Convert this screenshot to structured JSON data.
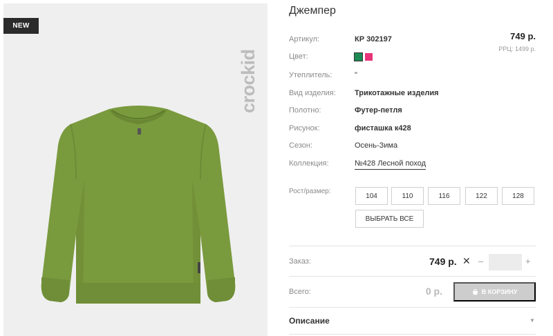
{
  "badge": "NEW",
  "brand": "crockid",
  "product": {
    "title": "Джемпер",
    "price": "749 р.",
    "rrp": "РРЦ: 1499 р."
  },
  "attributes": {
    "sku": {
      "label": "Артикул:",
      "value": "КР 302197"
    },
    "color": {
      "label": "Цвет:",
      "swatches": [
        "#1d8a55",
        "#e8347a"
      ]
    },
    "insulation": {
      "label": "Утеплитель:",
      "value": "\""
    },
    "type": {
      "label": "Вид изделия:",
      "value": "Трикотажные изделия"
    },
    "fabric": {
      "label": "Полотно:",
      "value": "Футер-петля"
    },
    "pattern": {
      "label": "Рисунок:",
      "value": "фисташка к428"
    },
    "season": {
      "label": "Сезон:",
      "value": "Осень-Зима"
    },
    "collection": {
      "label": "Коллекция:",
      "value": "№428 Лесной поход"
    }
  },
  "sizes": {
    "label": "Рост/размер:",
    "options": [
      "104",
      "110",
      "116",
      "122",
      "128"
    ],
    "select_all": "ВЫБРАТЬ ВСЕ"
  },
  "order": {
    "label": "Заказ:",
    "price": "749 р.",
    "times": "✕",
    "minus": "–",
    "quantity": "",
    "plus": "+"
  },
  "total": {
    "label": "Всего:",
    "value": "0 р.",
    "cart_button": "В КОРЗИНУ"
  },
  "description": {
    "label": "Описание",
    "chevron": "▼"
  },
  "colors": {
    "garment": "#7a9a3e",
    "button_disabled": "#cdcdcd"
  }
}
